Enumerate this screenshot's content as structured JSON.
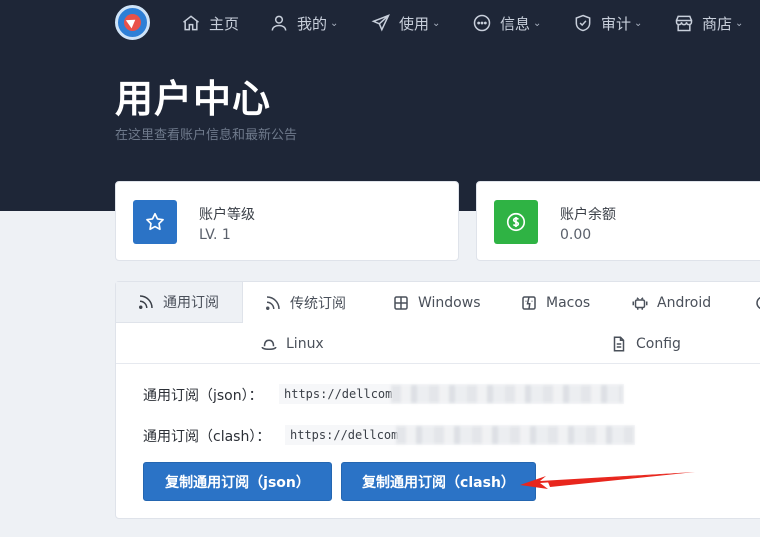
{
  "nav": {
    "items": [
      {
        "label": "主页",
        "icon": "home-icon",
        "has_menu": false
      },
      {
        "label": "我的",
        "icon": "user-icon",
        "has_menu": true
      },
      {
        "label": "使用",
        "icon": "send-icon",
        "has_menu": true
      },
      {
        "label": "信息",
        "icon": "more-circle-icon",
        "has_menu": true
      },
      {
        "label": "审计",
        "icon": "shield-check-icon",
        "has_menu": true
      },
      {
        "label": "商店",
        "icon": "store-icon",
        "has_menu": true
      }
    ]
  },
  "header": {
    "title": "用户中心",
    "subtitle": "在这里查看账户信息和最新公告"
  },
  "stats": [
    {
      "label": "账户等级",
      "value": "LV. 1",
      "icon": "star-icon",
      "color": "#2b73c6"
    },
    {
      "label": "账户余额",
      "value": "0.00",
      "icon": "dollar-icon",
      "color": "#2fb344"
    }
  ],
  "tabs": [
    {
      "label": "通用订阅",
      "icon": "rss-icon",
      "active": true
    },
    {
      "label": "传统订阅",
      "icon": "rss-icon",
      "active": false
    },
    {
      "label": "Windows",
      "icon": "windows-icon",
      "active": false
    },
    {
      "label": "Macos",
      "icon": "finder-icon",
      "active": false
    },
    {
      "label": "Android",
      "icon": "android-icon",
      "active": false
    },
    {
      "label": "Linux",
      "icon": "hat-icon",
      "active": false
    },
    {
      "label": "Config",
      "icon": "file-text-icon",
      "active": false
    }
  ],
  "subscriptions": [
    {
      "label": "通用订阅（json）：",
      "url": "https://dellcom"
    },
    {
      "label": "通用订阅（clash）：",
      "url": "https://dellcom"
    }
  ],
  "buttons": {
    "copy_json": "复制通用订阅（json）",
    "copy_clash": "复制通用订阅（clash）"
  },
  "colors": {
    "header_bg": "#1e2637",
    "primary": "#2b73c6",
    "success": "#2fb344",
    "annotation_arrow": "#e8261d"
  }
}
